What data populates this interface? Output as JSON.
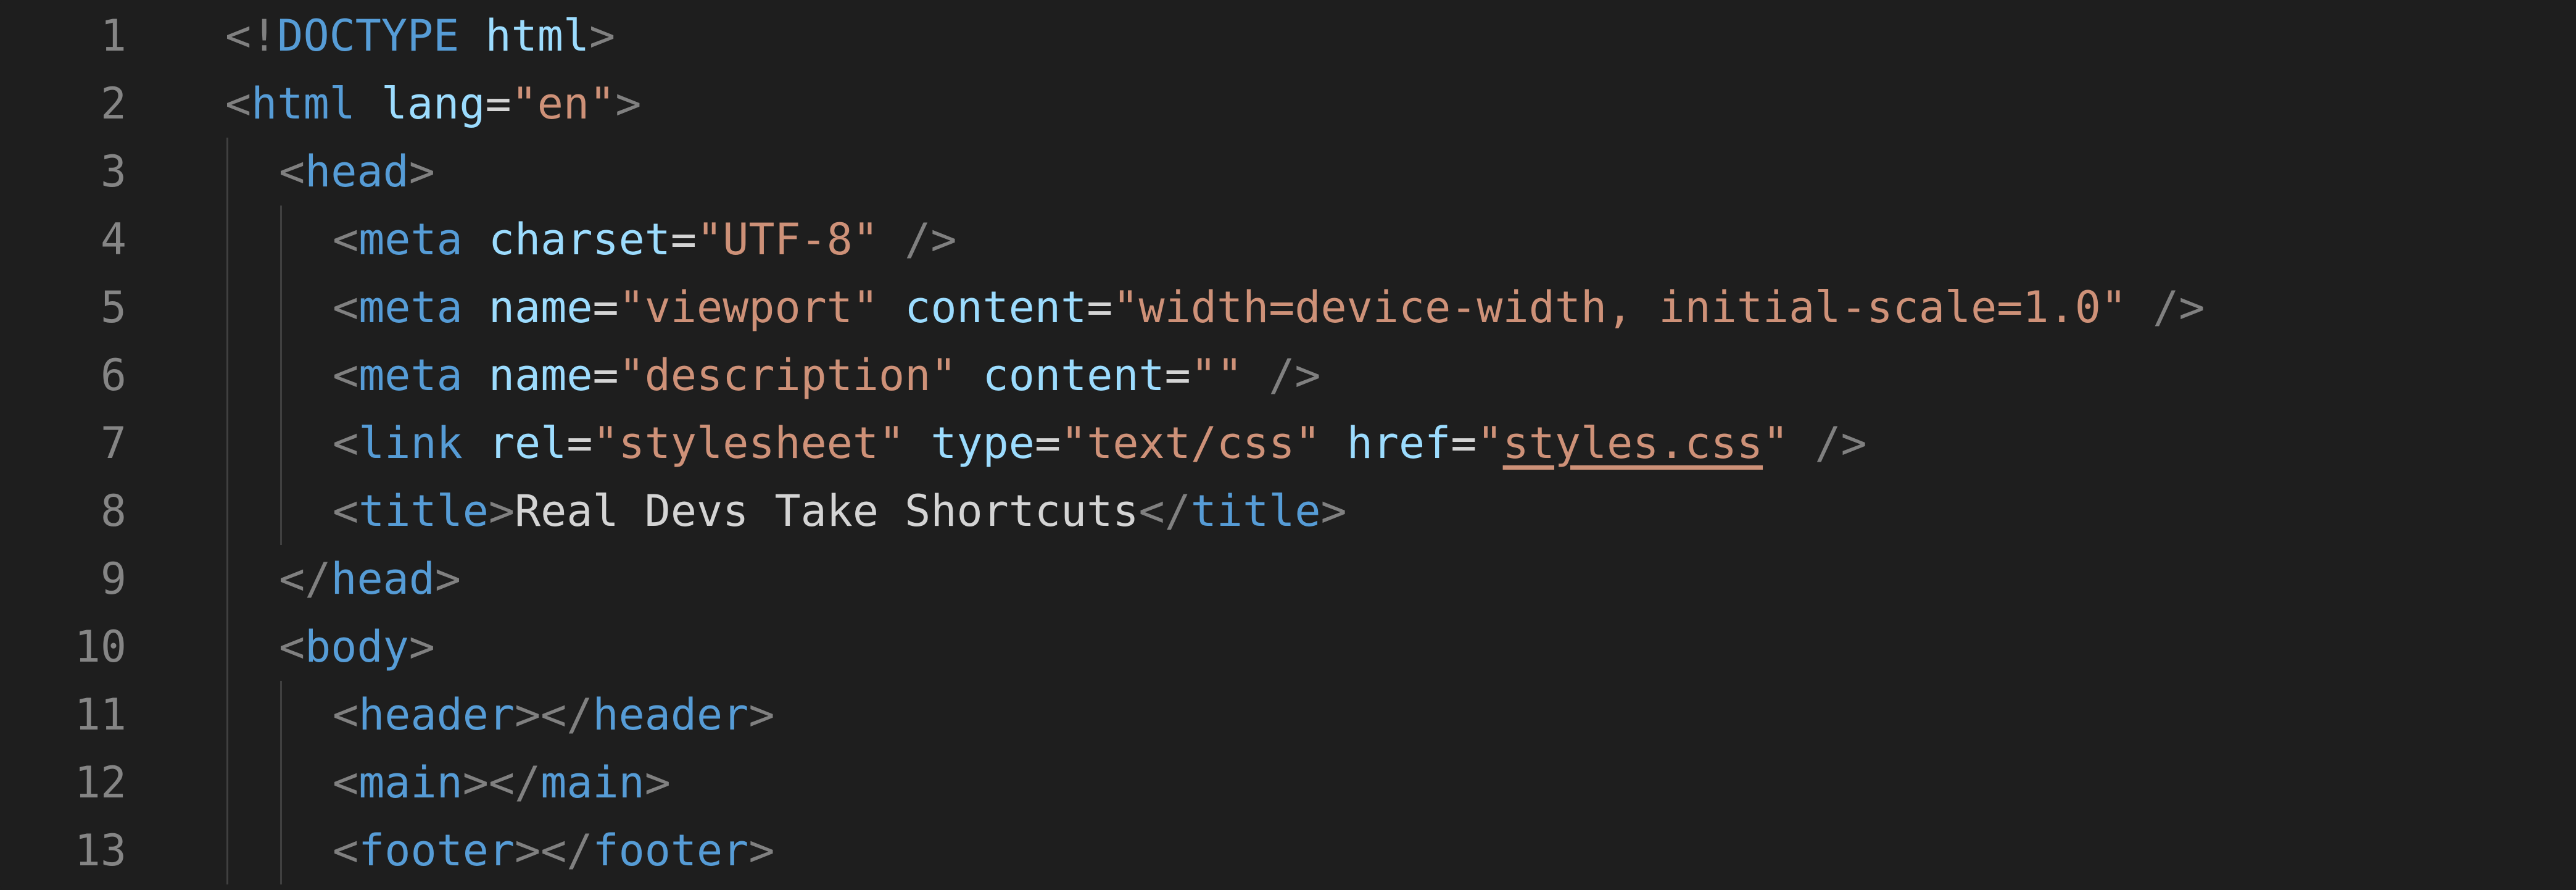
{
  "editor": {
    "language": "html",
    "colors": {
      "background": "#1e1e1e",
      "line_number": "#858585",
      "tag": "#569cd6",
      "punctuation": "#808080",
      "attribute": "#9cdcfe",
      "string": "#ce9178",
      "text": "#d4d4d4"
    },
    "lines": [
      {
        "n": "1",
        "indent": 0,
        "tokens": [
          [
            "p",
            "<!"
          ],
          [
            "t",
            "DOCTYPE"
          ],
          [
            "s",
            " "
          ],
          [
            "a",
            "html"
          ],
          [
            "p",
            ">"
          ]
        ]
      },
      {
        "n": "2",
        "indent": 0,
        "tokens": [
          [
            "p",
            "<"
          ],
          [
            "t",
            "html"
          ],
          [
            "s",
            " "
          ],
          [
            "a",
            "lang"
          ],
          [
            "x",
            "="
          ],
          [
            "q",
            "\"en\""
          ],
          [
            "p",
            ">"
          ]
        ]
      },
      {
        "n": "3",
        "indent": 1,
        "tokens": [
          [
            "p",
            "<"
          ],
          [
            "t",
            "head"
          ],
          [
            "p",
            ">"
          ]
        ]
      },
      {
        "n": "4",
        "indent": 2,
        "tokens": [
          [
            "p",
            "<"
          ],
          [
            "t",
            "meta"
          ],
          [
            "s",
            " "
          ],
          [
            "a",
            "charset"
          ],
          [
            "x",
            "="
          ],
          [
            "q",
            "\"UTF-8\""
          ],
          [
            "s",
            " "
          ],
          [
            "p",
            "/>"
          ]
        ]
      },
      {
        "n": "5",
        "indent": 2,
        "tokens": [
          [
            "p",
            "<"
          ],
          [
            "t",
            "meta"
          ],
          [
            "s",
            " "
          ],
          [
            "a",
            "name"
          ],
          [
            "x",
            "="
          ],
          [
            "q",
            "\"viewport\""
          ],
          [
            "s",
            " "
          ],
          [
            "a",
            "content"
          ],
          [
            "x",
            "="
          ],
          [
            "q",
            "\"width=device-width, initial-scale=1.0\""
          ],
          [
            "s",
            " "
          ],
          [
            "p",
            "/>"
          ]
        ]
      },
      {
        "n": "6",
        "indent": 2,
        "tokens": [
          [
            "p",
            "<"
          ],
          [
            "t",
            "meta"
          ],
          [
            "s",
            " "
          ],
          [
            "a",
            "name"
          ],
          [
            "x",
            "="
          ],
          [
            "q",
            "\"description\""
          ],
          [
            "s",
            " "
          ],
          [
            "a",
            "content"
          ],
          [
            "x",
            "="
          ],
          [
            "q",
            "\"\""
          ],
          [
            "s",
            " "
          ],
          [
            "p",
            "/>"
          ]
        ]
      },
      {
        "n": "7",
        "indent": 2,
        "tokens": [
          [
            "p",
            "<"
          ],
          [
            "t",
            "link"
          ],
          [
            "s",
            " "
          ],
          [
            "a",
            "rel"
          ],
          [
            "x",
            "="
          ],
          [
            "q",
            "\"stylesheet\""
          ],
          [
            "s",
            " "
          ],
          [
            "a",
            "type"
          ],
          [
            "x",
            "="
          ],
          [
            "q",
            "\"text/css\""
          ],
          [
            "s",
            " "
          ],
          [
            "a",
            "href"
          ],
          [
            "x",
            "="
          ],
          [
            "q",
            "\""
          ],
          [
            "u",
            "styles.css"
          ],
          [
            "q",
            "\""
          ],
          [
            "s",
            " "
          ],
          [
            "p",
            "/>"
          ]
        ]
      },
      {
        "n": "8",
        "indent": 2,
        "tokens": [
          [
            "p",
            "<"
          ],
          [
            "t",
            "title"
          ],
          [
            "p",
            ">"
          ],
          [
            "x",
            "Real Devs Take Shortcuts"
          ],
          [
            "p",
            "</"
          ],
          [
            "t",
            "title"
          ],
          [
            "p",
            ">"
          ]
        ]
      },
      {
        "n": "9",
        "indent": 1,
        "tokens": [
          [
            "p",
            "</"
          ],
          [
            "t",
            "head"
          ],
          [
            "p",
            ">"
          ]
        ]
      },
      {
        "n": "10",
        "indent": 1,
        "tokens": [
          [
            "p",
            "<"
          ],
          [
            "t",
            "body"
          ],
          [
            "p",
            ">"
          ]
        ]
      },
      {
        "n": "11",
        "indent": 2,
        "tokens": [
          [
            "p",
            "<"
          ],
          [
            "t",
            "header"
          ],
          [
            "p",
            "></"
          ],
          [
            "t",
            "header"
          ],
          [
            "p",
            ">"
          ]
        ]
      },
      {
        "n": "12",
        "indent": 2,
        "tokens": [
          [
            "p",
            "<"
          ],
          [
            "t",
            "main"
          ],
          [
            "p",
            "></"
          ],
          [
            "t",
            "main"
          ],
          [
            "p",
            ">"
          ]
        ]
      },
      {
        "n": "13",
        "indent": 2,
        "tokens": [
          [
            "p",
            "<"
          ],
          [
            "t",
            "footer"
          ],
          [
            "p",
            "></"
          ],
          [
            "t",
            "footer"
          ],
          [
            "p",
            ">"
          ]
        ]
      }
    ]
  }
}
